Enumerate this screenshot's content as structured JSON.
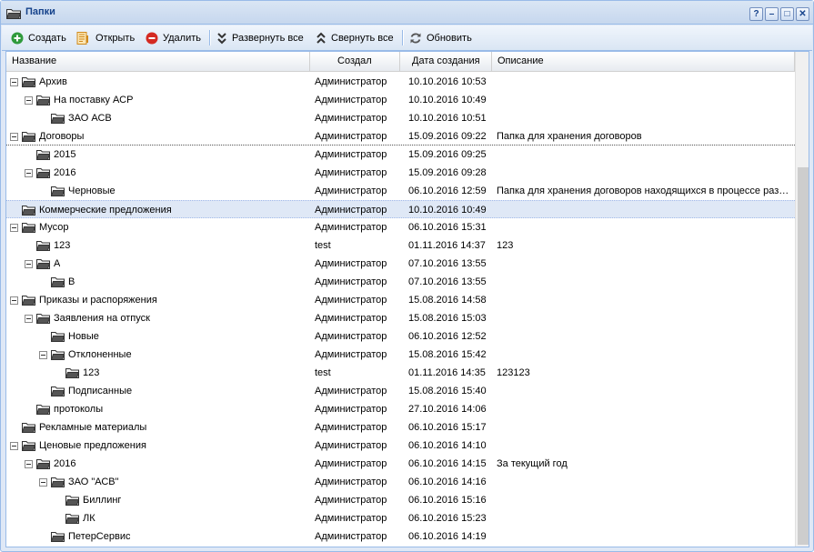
{
  "window": {
    "title": "Папки",
    "tools": [
      "?",
      "–",
      "□",
      "✕"
    ]
  },
  "toolbar": {
    "create": "Создать",
    "open": "Открыть",
    "delete": "Удалить",
    "expand_all": "Развернуть все",
    "collapse_all": "Свернуть все",
    "refresh": "Обновить"
  },
  "columns": {
    "name": "Название",
    "author": "Создал",
    "date": "Дата создания",
    "description": "Описание"
  },
  "rows": [
    {
      "name": "Архив",
      "author": "Администратор",
      "date": "10.10.2016 10:53",
      "desc": "",
      "level": 0,
      "expanded": true
    },
    {
      "name": "На поставку АСР",
      "author": "Администратор",
      "date": "10.10.2016 10:49",
      "desc": "",
      "level": 1,
      "expanded": true
    },
    {
      "name": "ЗАО АСВ",
      "author": "Администратор",
      "date": "10.10.2016 10:51",
      "desc": "",
      "level": 2,
      "expanded": false
    },
    {
      "name": "Договоры",
      "author": "Администратор",
      "date": "15.09.2016 09:22",
      "desc": "Папка для хранения договоров",
      "level": 0,
      "expanded": true
    },
    {
      "name": "2015",
      "author": "Администратор",
      "date": "15.09.2016 09:25",
      "desc": "",
      "level": 1,
      "expanded": false
    },
    {
      "name": "2016",
      "author": "Администратор",
      "date": "15.09.2016 09:28",
      "desc": "",
      "level": 1,
      "expanded": true
    },
    {
      "name": "Черновые",
      "author": "Администратор",
      "date": "06.10.2016 12:59",
      "desc": "Папка для хранения договоров находящихся в процессе разработки",
      "level": 2,
      "expanded": false
    },
    {
      "name": "Коммерческие предложения",
      "author": "Администратор",
      "date": "10.10.2016 10:49",
      "desc": "",
      "level": 0,
      "expanded": false
    },
    {
      "name": "Мусор",
      "author": "Администратор",
      "date": "06.10.2016 15:31",
      "desc": "",
      "level": 0,
      "expanded": true
    },
    {
      "name": "123",
      "author": "test",
      "date": "01.11.2016 14:37",
      "desc": "123",
      "level": 1,
      "expanded": false
    },
    {
      "name": "А",
      "author": "Администратор",
      "date": "07.10.2016 13:55",
      "desc": "",
      "level": 1,
      "expanded": true
    },
    {
      "name": "В",
      "author": "Администратор",
      "date": "07.10.2016 13:55",
      "desc": "",
      "level": 2,
      "expanded": false
    },
    {
      "name": "Приказы и распоряжения",
      "author": "Администратор",
      "date": "15.08.2016 14:58",
      "desc": "",
      "level": 0,
      "expanded": true
    },
    {
      "name": "Заявления на отпуск",
      "author": "Администратор",
      "date": "15.08.2016 15:03",
      "desc": "",
      "level": 1,
      "expanded": true
    },
    {
      "name": "Новые",
      "author": "Администратор",
      "date": "06.10.2016 12:52",
      "desc": "",
      "level": 2,
      "expanded": false
    },
    {
      "name": "Отклоненные",
      "author": "Администратор",
      "date": "15.08.2016 15:42",
      "desc": "",
      "level": 2,
      "expanded": true
    },
    {
      "name": "123",
      "author": "test",
      "date": "01.11.2016 14:35",
      "desc": "123123",
      "level": 3,
      "expanded": false
    },
    {
      "name": "Подписанные",
      "author": "Администратор",
      "date": "15.08.2016 15:40",
      "desc": "",
      "level": 2,
      "expanded": false
    },
    {
      "name": "протоколы",
      "author": "Администратор",
      "date": "27.10.2016 14:06",
      "desc": "",
      "level": 1,
      "expanded": false
    },
    {
      "name": "Рекламные материалы",
      "author": "Администратор",
      "date": "06.10.2016 15:17",
      "desc": "",
      "level": 0,
      "expanded": false
    },
    {
      "name": "Ценовые предложения",
      "author": "Администратор",
      "date": "06.10.2016 14:10",
      "desc": "",
      "level": 0,
      "expanded": true
    },
    {
      "name": "2016",
      "author": "Администратор",
      "date": "06.10.2016 14:15",
      "desc": "За текущий год",
      "level": 1,
      "expanded": true
    },
    {
      "name": "ЗАО \"АСВ\"",
      "author": "Администратор",
      "date": "06.10.2016 14:16",
      "desc": "",
      "level": 2,
      "expanded": true
    },
    {
      "name": "Биллинг",
      "author": "Администратор",
      "date": "06.10.2016 15:16",
      "desc": "",
      "level": 3,
      "expanded": false
    },
    {
      "name": "ЛК",
      "author": "Администратор",
      "date": "06.10.2016 15:23",
      "desc": "",
      "level": 3,
      "expanded": false
    },
    {
      "name": "ПетерСервис",
      "author": "Администратор",
      "date": "06.10.2016 14:19",
      "desc": "",
      "level": 2,
      "expanded": false
    }
  ],
  "selected_row": 7,
  "icons": {
    "create": "plus-circle-icon",
    "open": "open-document-icon",
    "delete": "minus-circle-icon",
    "expand_all": "double-chevron-down-icon",
    "collapse_all": "double-chevron-up-icon",
    "refresh": "refresh-icon",
    "folder": "folder-icon"
  }
}
